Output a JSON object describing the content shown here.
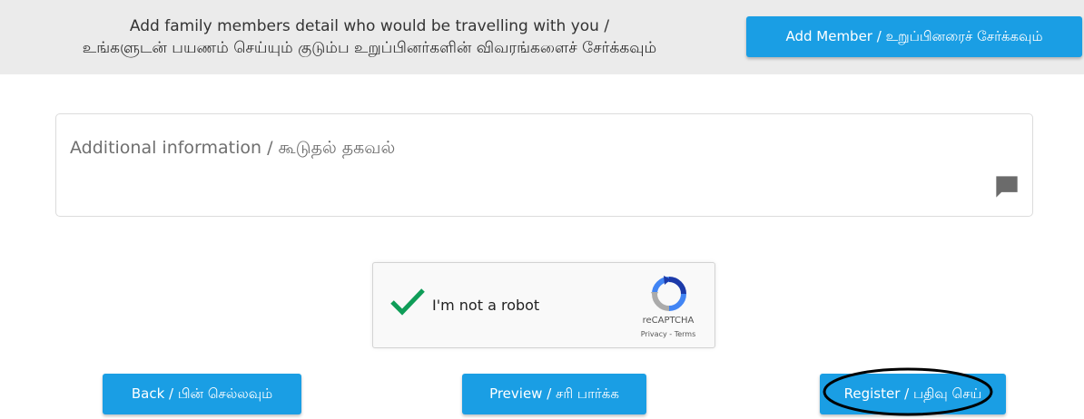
{
  "banner": {
    "line1": "Add family members detail who would be travelling with you /",
    "line2": "உங்களுடன் பயணம் செய்யும் குடும்ப உறுப்பினர்களின் விவரங்களைச் சேர்க்கவும்",
    "add_member_label": "Add Member / உறுப்பினரைச் சேர்க்கவும்"
  },
  "additional_info": {
    "placeholder": "Additional information / கூடுதல் தகவல்",
    "icon": "comment-icon"
  },
  "captcha": {
    "label": "I'm not a robot",
    "brand": "reCAPTCHA",
    "privacy": "Privacy",
    "separator": " - ",
    "terms": "Terms",
    "checked": true
  },
  "actions": {
    "back_label": "Back / பின் செல்லவும்",
    "preview_label": "Preview / சரி பார்க்க",
    "register_label": "Register / பதிவு செய்"
  },
  "colors": {
    "primary": "#1a9ee4",
    "banner_bg": "#ebebeb",
    "check": "#0f9d58"
  }
}
